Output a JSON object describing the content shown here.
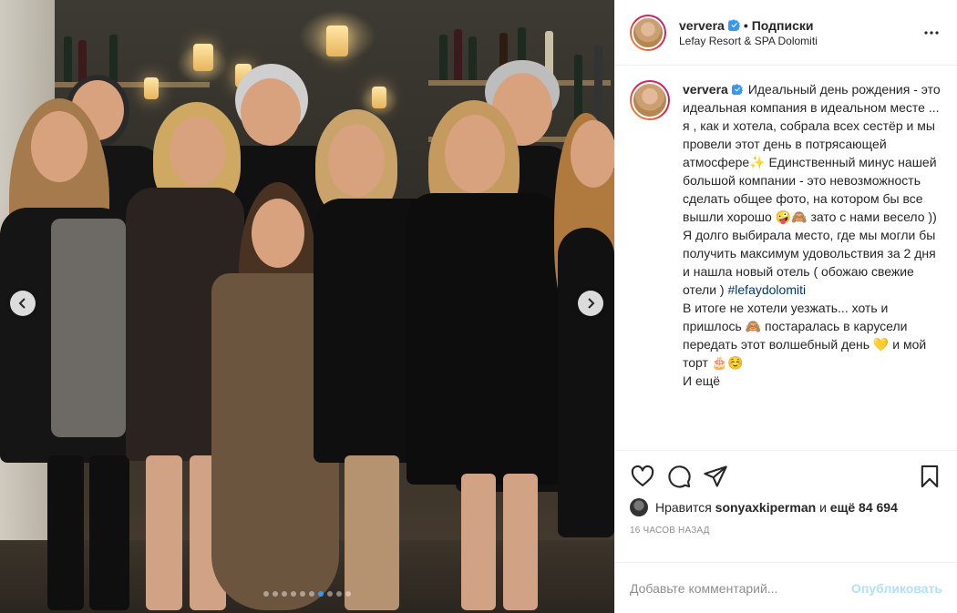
{
  "header": {
    "username": "ververa",
    "separator": "•",
    "follow_label": "Подписки",
    "location": "Lefay Resort & SPA Dolomiti",
    "more_icon": "more-horizontal-icon"
  },
  "caption": {
    "username": "ververa",
    "text_part1": "Идеальный день рождения - это идеальная компания в идеальном месте ... я , как и хотела, собрала всех сестёр и мы провели этот день в потрясающей атмосфере✨ Единственный минус нашей большой компании - это невозможность сделать общее фото, на котором бы все вышли хорошо 🤪🙈 зато с нами весело )) Я долго выбирала место, где мы могли бы получить максимум удовольствия за 2 дня и нашла новый отель ( обожаю свежие отели ) ",
    "hashtag": "#lefaydolomiti",
    "text_part2": "\nВ итоге не хотели уезжать... хоть и пришлось 🙈 постаралась в карусели передать этот волшебный день 💛 и мой торт 🎂☺️\nИ ещё"
  },
  "actions": {
    "like_icon": "heart-icon",
    "comment_icon": "comment-icon",
    "share_icon": "share-icon",
    "save_icon": "bookmark-icon"
  },
  "likes": {
    "prefix": "Нравится",
    "user": "sonyaxkiperman",
    "and": "и",
    "count": "ещё 84 694"
  },
  "timestamp": "16 часов назад",
  "comment": {
    "placeholder": "Добавьте комментарий...",
    "publish_label": "Опубликовать"
  },
  "carousel": {
    "total_slides": 10,
    "active_index": 6
  },
  "colors": {
    "accent": "#3897f0",
    "verified": "#3897f0",
    "publish_disabled": "#b2dffc",
    "hashtag": "#00376b"
  }
}
